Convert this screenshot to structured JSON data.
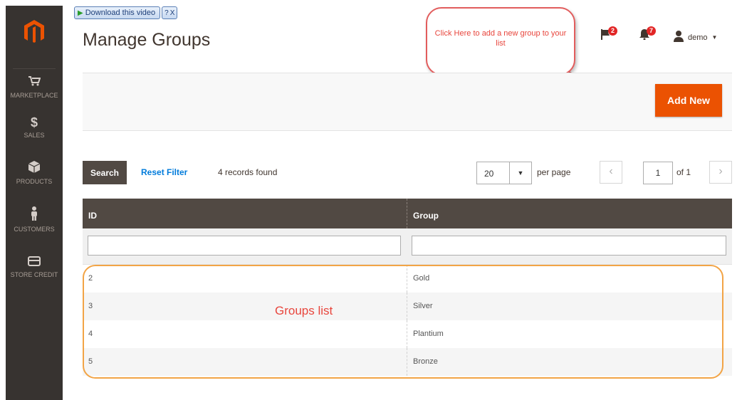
{
  "download_bar": {
    "label": "Download this video",
    "help": "?",
    "close": "X"
  },
  "sidebar": {
    "items": [
      {
        "label": "MARKETPLACE",
        "icon": "cart-icon"
      },
      {
        "label": "SALES",
        "icon": "dollar-icon"
      },
      {
        "label": "PRODUCTS",
        "icon": "box-icon"
      },
      {
        "label": "CUSTOMERS",
        "icon": "person-icon"
      },
      {
        "label": "STORE CREDIT",
        "icon": "card-icon"
      }
    ]
  },
  "header": {
    "title": "Manage Groups",
    "notifications": {
      "flag_count": "2",
      "bell_count": "7"
    },
    "user": "demo"
  },
  "callout": {
    "text": "Click Here to add a new group to your list"
  },
  "actions": {
    "add_new": "Add New"
  },
  "toolbar": {
    "search": "Search",
    "reset_filter": "Reset Filter",
    "records_found": "4 records found",
    "per_page_value": "20",
    "per_page_label": "per page",
    "prev": "‹",
    "next": "›",
    "current_page": "1",
    "of_pages": "of 1"
  },
  "grid": {
    "columns": [
      "ID",
      "Group"
    ],
    "rows": [
      {
        "id": "2",
        "group": "Gold"
      },
      {
        "id": "3",
        "group": "Silver"
      },
      {
        "id": "4",
        "group": "Plantium"
      },
      {
        "id": "5",
        "group": "Bronze"
      }
    ]
  },
  "annotation": {
    "groups_list": "Groups list"
  },
  "colors": {
    "accent": "#eb5202",
    "sidebar": "#373330",
    "header": "#514943",
    "callout": "#e25d5d",
    "highlight": "#f2a446"
  }
}
